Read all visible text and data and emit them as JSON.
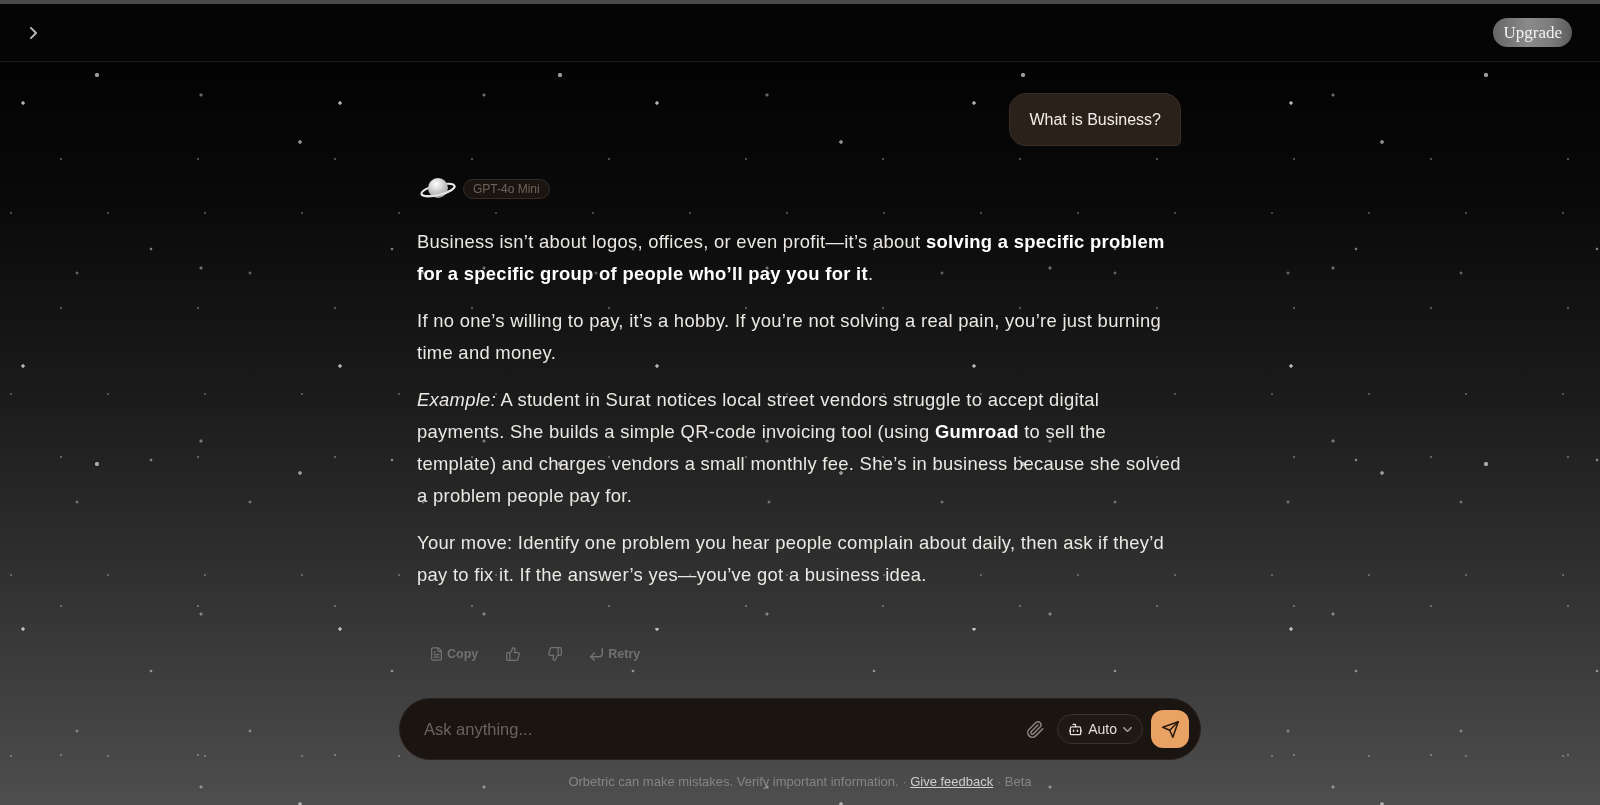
{
  "header": {
    "upgrade_button": "Upgrade"
  },
  "conversation": {
    "user_message": "What is Business?",
    "model_badge": "GPT-4o Mini",
    "paragraphs": [
      "Business isn’t about logos, offices, or even profit—it’s about **solving a specific problem for a specific group of people who’ll pay you for it**.",
      "If no one’s willing to pay, it’s a hobby. If you’re not solving a real pain, you’re just burning time and money.",
      "*Example:* A student in Surat notices local street vendors struggle to accept digital payments. She builds a simple QR-code invoicing tool (using **Gumroad** to sell the template) and charges vendors a small monthly fee. She’s in business because she solved a problem people pay for.",
      "Your move: Identify one problem you hear people complain about daily, then ask if they’d pay to fix it. If the answer’s yes—you’ve got a business idea."
    ],
    "actions": [
      {
        "kind": "copy",
        "label": "Copy"
      },
      {
        "kind": "like"
      },
      {
        "kind": "dislike"
      },
      {
        "kind": "retry",
        "label": "Retry"
      }
    ]
  },
  "composer": {
    "placeholder": "Ask anything...",
    "mode": "Auto"
  },
  "footer": {
    "before": "Orbetric can make mistakes. Verify important information. ·",
    "link": "Give feedback",
    "after": "· Beta"
  }
}
